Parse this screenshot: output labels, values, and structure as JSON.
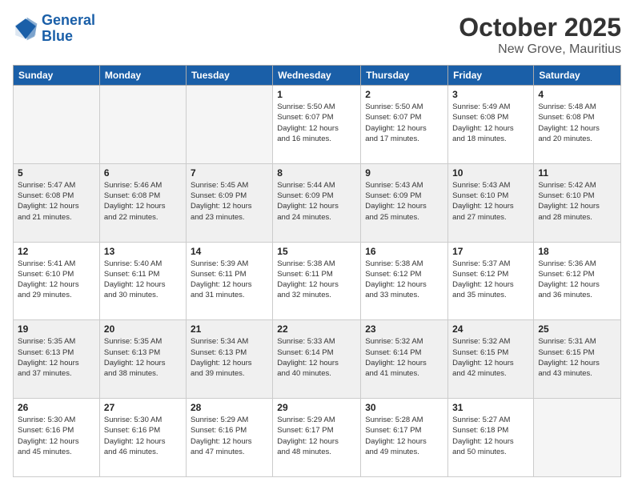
{
  "header": {
    "logo": {
      "line1": "General",
      "line2": "Blue"
    },
    "month": "October 2025",
    "location": "New Grove, Mauritius"
  },
  "weekdays": [
    "Sunday",
    "Monday",
    "Tuesday",
    "Wednesday",
    "Thursday",
    "Friday",
    "Saturday"
  ],
  "weeks": [
    [
      {
        "day": "",
        "info": ""
      },
      {
        "day": "",
        "info": ""
      },
      {
        "day": "",
        "info": ""
      },
      {
        "day": "1",
        "info": "Sunrise: 5:50 AM\nSunset: 6:07 PM\nDaylight: 12 hours\nand 16 minutes."
      },
      {
        "day": "2",
        "info": "Sunrise: 5:50 AM\nSunset: 6:07 PM\nDaylight: 12 hours\nand 17 minutes."
      },
      {
        "day": "3",
        "info": "Sunrise: 5:49 AM\nSunset: 6:08 PM\nDaylight: 12 hours\nand 18 minutes."
      },
      {
        "day": "4",
        "info": "Sunrise: 5:48 AM\nSunset: 6:08 PM\nDaylight: 12 hours\nand 20 minutes."
      }
    ],
    [
      {
        "day": "5",
        "info": "Sunrise: 5:47 AM\nSunset: 6:08 PM\nDaylight: 12 hours\nand 21 minutes."
      },
      {
        "day": "6",
        "info": "Sunrise: 5:46 AM\nSunset: 6:08 PM\nDaylight: 12 hours\nand 22 minutes."
      },
      {
        "day": "7",
        "info": "Sunrise: 5:45 AM\nSunset: 6:09 PM\nDaylight: 12 hours\nand 23 minutes."
      },
      {
        "day": "8",
        "info": "Sunrise: 5:44 AM\nSunset: 6:09 PM\nDaylight: 12 hours\nand 24 minutes."
      },
      {
        "day": "9",
        "info": "Sunrise: 5:43 AM\nSunset: 6:09 PM\nDaylight: 12 hours\nand 25 minutes."
      },
      {
        "day": "10",
        "info": "Sunrise: 5:43 AM\nSunset: 6:10 PM\nDaylight: 12 hours\nand 27 minutes."
      },
      {
        "day": "11",
        "info": "Sunrise: 5:42 AM\nSunset: 6:10 PM\nDaylight: 12 hours\nand 28 minutes."
      }
    ],
    [
      {
        "day": "12",
        "info": "Sunrise: 5:41 AM\nSunset: 6:10 PM\nDaylight: 12 hours\nand 29 minutes."
      },
      {
        "day": "13",
        "info": "Sunrise: 5:40 AM\nSunset: 6:11 PM\nDaylight: 12 hours\nand 30 minutes."
      },
      {
        "day": "14",
        "info": "Sunrise: 5:39 AM\nSunset: 6:11 PM\nDaylight: 12 hours\nand 31 minutes."
      },
      {
        "day": "15",
        "info": "Sunrise: 5:38 AM\nSunset: 6:11 PM\nDaylight: 12 hours\nand 32 minutes."
      },
      {
        "day": "16",
        "info": "Sunrise: 5:38 AM\nSunset: 6:12 PM\nDaylight: 12 hours\nand 33 minutes."
      },
      {
        "day": "17",
        "info": "Sunrise: 5:37 AM\nSunset: 6:12 PM\nDaylight: 12 hours\nand 35 minutes."
      },
      {
        "day": "18",
        "info": "Sunrise: 5:36 AM\nSunset: 6:12 PM\nDaylight: 12 hours\nand 36 minutes."
      }
    ],
    [
      {
        "day": "19",
        "info": "Sunrise: 5:35 AM\nSunset: 6:13 PM\nDaylight: 12 hours\nand 37 minutes."
      },
      {
        "day": "20",
        "info": "Sunrise: 5:35 AM\nSunset: 6:13 PM\nDaylight: 12 hours\nand 38 minutes."
      },
      {
        "day": "21",
        "info": "Sunrise: 5:34 AM\nSunset: 6:13 PM\nDaylight: 12 hours\nand 39 minutes."
      },
      {
        "day": "22",
        "info": "Sunrise: 5:33 AM\nSunset: 6:14 PM\nDaylight: 12 hours\nand 40 minutes."
      },
      {
        "day": "23",
        "info": "Sunrise: 5:32 AM\nSunset: 6:14 PM\nDaylight: 12 hours\nand 41 minutes."
      },
      {
        "day": "24",
        "info": "Sunrise: 5:32 AM\nSunset: 6:15 PM\nDaylight: 12 hours\nand 42 minutes."
      },
      {
        "day": "25",
        "info": "Sunrise: 5:31 AM\nSunset: 6:15 PM\nDaylight: 12 hours\nand 43 minutes."
      }
    ],
    [
      {
        "day": "26",
        "info": "Sunrise: 5:30 AM\nSunset: 6:16 PM\nDaylight: 12 hours\nand 45 minutes."
      },
      {
        "day": "27",
        "info": "Sunrise: 5:30 AM\nSunset: 6:16 PM\nDaylight: 12 hours\nand 46 minutes."
      },
      {
        "day": "28",
        "info": "Sunrise: 5:29 AM\nSunset: 6:16 PM\nDaylight: 12 hours\nand 47 minutes."
      },
      {
        "day": "29",
        "info": "Sunrise: 5:29 AM\nSunset: 6:17 PM\nDaylight: 12 hours\nand 48 minutes."
      },
      {
        "day": "30",
        "info": "Sunrise: 5:28 AM\nSunset: 6:17 PM\nDaylight: 12 hours\nand 49 minutes."
      },
      {
        "day": "31",
        "info": "Sunrise: 5:27 AM\nSunset: 6:18 PM\nDaylight: 12 hours\nand 50 minutes."
      },
      {
        "day": "",
        "info": ""
      }
    ]
  ]
}
